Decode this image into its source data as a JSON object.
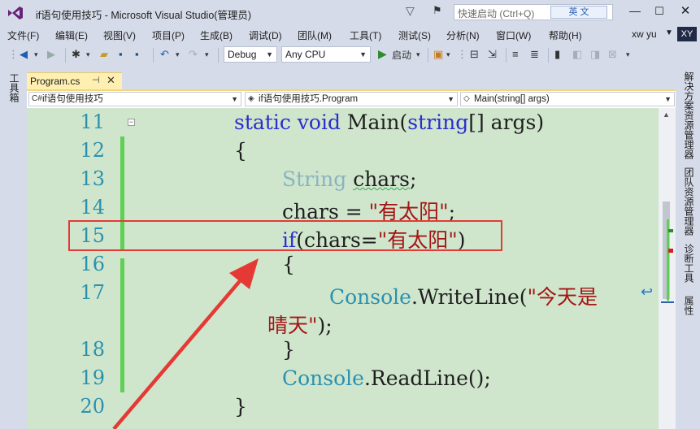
{
  "window": {
    "title": "if语句使用技巧 - Microsoft Visual Studio(管理员)",
    "quick_launch_placeholder": "快速启动 (Ctrl+Q)",
    "ime_indicator": "英 文",
    "min_glyph": "—",
    "max_glyph": "☐",
    "close_glyph": "✕"
  },
  "menu": {
    "items": [
      "文件(F)",
      "编辑(E)",
      "视图(V)",
      "项目(P)",
      "生成(B)",
      "调试(D)",
      "团队(M)",
      "工具(T)",
      "测试(S)",
      "分析(N)",
      "窗口(W)",
      "帮助(H)"
    ],
    "user": "xw yu",
    "avatar": "XY"
  },
  "toolbar": {
    "configuration": "Debug",
    "platform": "Any CPU",
    "start_label": "启动"
  },
  "side": {
    "left_label": "工具箱",
    "right_tabs": [
      "解决方案资源管理器",
      "团队资源管理器",
      "诊断工具",
      "属性"
    ]
  },
  "document": {
    "tab_label": "Program.cs",
    "nav_project": "if语句使用技巧",
    "nav_class": "if语句使用技巧.Program",
    "nav_member": "Main(string[] args)"
  },
  "editor": {
    "line_numbers": [
      "11",
      "12",
      "13",
      "14",
      "15",
      "16",
      "17",
      "18",
      "19",
      "20"
    ],
    "lines": {
      "l11": {
        "kw1": "static",
        "kw2": "void",
        "name": " Main(",
        "kw3": "string",
        "rest": "[] args)"
      },
      "l12": "{",
      "l13": {
        "type": "String",
        "rest": " ",
        "squig": "chars",
        "end": ";"
      },
      "l14": {
        "pre": "chars = ",
        "str": "\"有太阳\"",
        "end": ";"
      },
      "l15": {
        "kw": "if",
        "pre": "(chars=",
        "str": "\"有太阳\"",
        "end": ")"
      },
      "l16": "{",
      "l17": {
        "type": "Console",
        "mid": ".WriteLine(",
        "str": "\"今天是"
      },
      "l17b": {
        "str": "晴天\"",
        "end": ");"
      },
      "l18": "}",
      "l19": {
        "type": "Console",
        "rest": ".ReadLine();"
      },
      "l20": "}"
    }
  },
  "colors": {
    "editor_bg": "#cfe6cc",
    "keyword": "#2c2ccf",
    "type": "#2b91af",
    "string": "#a31515",
    "highlight": "#e53935"
  }
}
